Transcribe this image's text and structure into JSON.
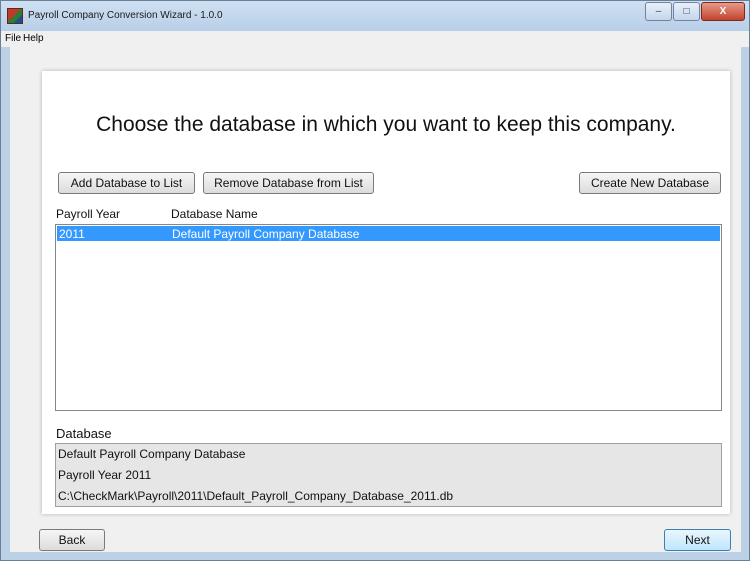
{
  "window": {
    "title": "Payroll Company Conversion Wizard - 1.0.0",
    "controls": {
      "minimize": "–",
      "maximize": "□",
      "close": "X"
    }
  },
  "menu": [
    "File",
    "Help"
  ],
  "main": {
    "heading": "Choose the database in which you want to keep this company.",
    "buttons": {
      "add": "Add Database to List",
      "remove": "Remove Database from List",
      "create": "Create New Database"
    },
    "columns": [
      "Payroll Year",
      "Database Name"
    ],
    "rows": [
      {
        "year": "2011",
        "name": "Default Payroll Company Database",
        "selected": true
      }
    ]
  },
  "details": {
    "label": "Database",
    "lines": [
      "Default Payroll Company Database",
      "Payroll Year 2011",
      "C:\\CheckMark\\Payroll\\2011\\Default_Payroll_Company_Database_2011.db"
    ]
  },
  "footer": {
    "back": "Back",
    "next": "Next"
  },
  "colors": {
    "selection": "#3399ff",
    "window_frame": "#bcd0e6"
  }
}
